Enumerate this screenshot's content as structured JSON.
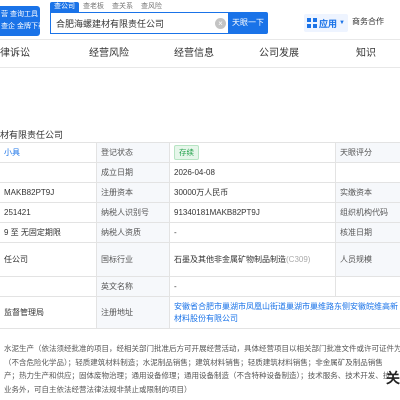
{
  "header": {
    "logo_line1": "营 查询工具",
    "logo_line2": "查企 金牌下载司",
    "search_tabs": [
      "查公司",
      "查老板",
      "查关系",
      "查风险"
    ],
    "search_value": "合肥海螺建材有限责任公司",
    "search_button": "天眼一下",
    "app_label": "应用",
    "biz_link": "商务合作"
  },
  "categories": [
    "律诉讼",
    "经营风险",
    "经营信息",
    "公司发展",
    "知识"
  ],
  "company_title": "材有限责任公司",
  "table": {
    "r1": {
      "c1": "小具",
      "c2": "登记状态",
      "c3": "存续",
      "c4": "天眼评分"
    },
    "r2": {
      "c2": "成立日期",
      "c3": "2026-04-08"
    },
    "r3": {
      "c1": "MAKB82PT9J",
      "c2": "注册资本",
      "c3": "30000万人民币",
      "c4": "实缴资本"
    },
    "r4": {
      "c1": "251421",
      "c2": "纳税人识别号",
      "c3": "91340181MAKB82PT9J",
      "c4": "组织机构代码"
    },
    "r5": {
      "c1": "9 至 无固定期限",
      "c2": "纳税人资质",
      "c3": "-",
      "c4": "核准日期"
    },
    "r6": {
      "c1": "任公司",
      "c2": "国标行业",
      "c3_main": "石墨及其他非金属矿物制品制造",
      "c3_code": "(C309)",
      "c4": "人员规模"
    },
    "r7": {
      "c2": "英文名称",
      "c3": "-"
    },
    "r8": {
      "c1": "监督管理局",
      "c2": "注册地址",
      "c3": "安徽省合肥市巢湖市凤凰山街道巢湖市巢维路东侧安徽皖维高新材料股份有限公司"
    }
  },
  "scope": [
    "水泥生产（依法须经批准的项目，经相关部门批准后方可开展经营活动，具体经营项目以相关部门批准文件或许可证件为准",
    "（不含危险化学品）；轻质建筑材料制造；水泥制品销售；建筑材料销售；轻质建筑材料销售；非金属矿及制品销售",
    "产；热力生产和供应；固体废物治理；通用设备修理；通用设备制造（不含特种设备制造）；技术服务、技术开发、技",
    "业务外，可自主依法经营法律法规非禁止或限制的项目）"
  ],
  "corner_mark": "关",
  "colors": {
    "accent": "#1a73e8",
    "status_green": "#21a049",
    "label_bg": "#f6f8fb"
  },
  "icons": {
    "clear": "close-circle-icon",
    "apps": "grid-icon",
    "caret": "chevron-down-icon"
  }
}
